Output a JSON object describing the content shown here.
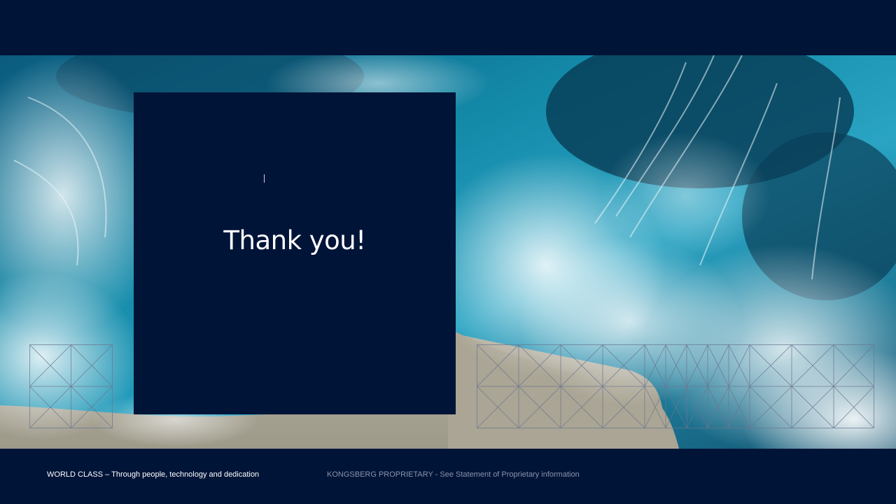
{
  "slide": {
    "title": "Thank you!",
    "cursor_mark": "|"
  },
  "footer": {
    "tagline": "WORLD CLASS  –  Through people, technology and dedication",
    "proprietary": "KONGSBERG PROPRIETARY  - See Statement of Proprietary information"
  },
  "colors": {
    "navy": "#001438",
    "ocean": "#1b8fb0",
    "foam": "#e6f4f8",
    "sand": "#a8a494"
  },
  "icons": [
    "ocean-photo",
    "grid-pattern"
  ]
}
